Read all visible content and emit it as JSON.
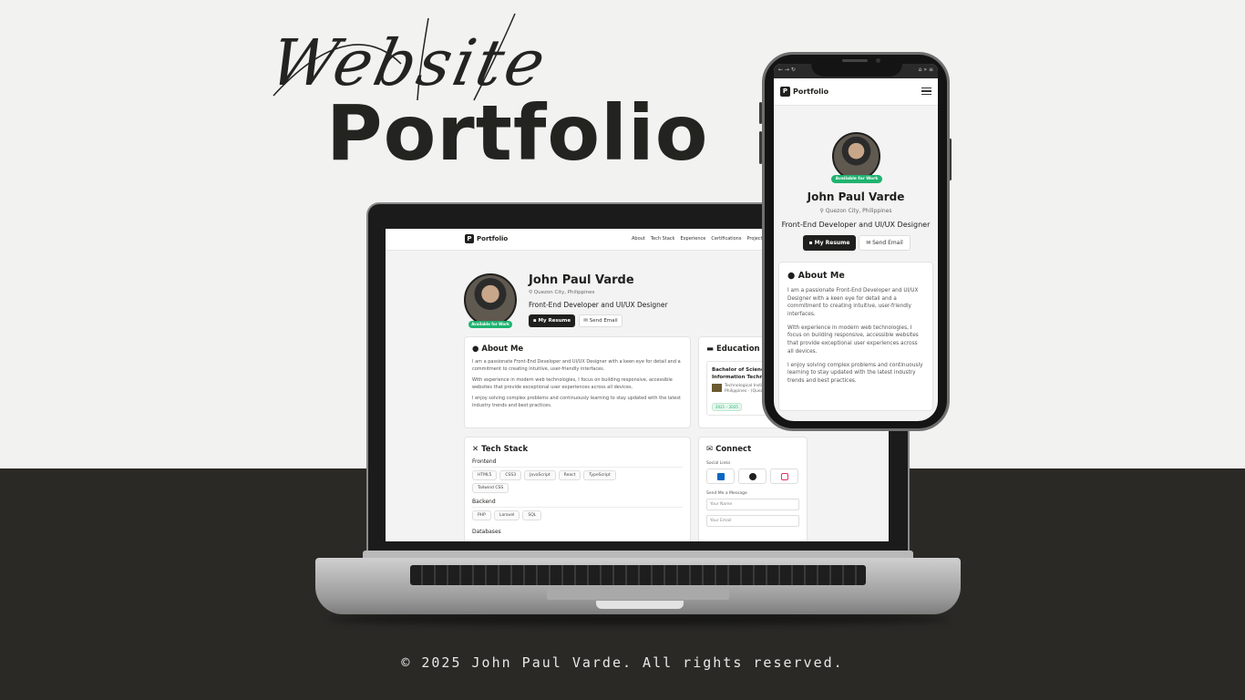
{
  "hero": {
    "script_word": "Website",
    "title": "Portfolio"
  },
  "footer": "© 2025 John Paul Varde. All rights reserved.",
  "site": {
    "logo_letter": "P",
    "logo": "Portfolio",
    "nav": [
      "About",
      "Tech Stack",
      "Experience",
      "Certifications",
      "Projects"
    ],
    "name": "John Paul Varde",
    "location": "Quezon City, Philippines",
    "role": "Front-End Developer and UI/UX Designer",
    "availability": "Available for Work",
    "resume_button": "My Resume",
    "email_button": "Send Email",
    "about": {
      "title": "About Me",
      "p1": "I am a passionate Front-End Developer and UI/UX Designer with a keen eye for detail and a commitment to creating intuitive, user-friendly interfaces.",
      "p2": "With experience in modern web technologies, I focus on building responsive, accessible websites that provide exceptional user experiences across all devices.",
      "p3": "I enjoy solving complex problems and continuously learning to stay updated with the latest industry trends and best practices."
    },
    "education": {
      "title": "Education",
      "degree": "Bachelor of Science in Information Technology",
      "school": "Technological Institute of the Philippines - (Quezon City)",
      "years": "2021 – 2025"
    },
    "tech": {
      "title": "Tech Stack",
      "groups": [
        {
          "name": "Frontend",
          "items": [
            "HTML5",
            "CSS3",
            "JavaScript",
            "React",
            "TypeScript",
            "Tailwind CSS"
          ]
        },
        {
          "name": "Backend",
          "items": [
            "PHP",
            "Laravel",
            "SQL"
          ]
        },
        {
          "name": "Databases",
          "items": []
        }
      ]
    },
    "connect": {
      "title": "Connect",
      "social_label": "Social Links",
      "message_label": "Send Me a Message",
      "name_placeholder": "Your Name",
      "email_placeholder": "Your Email"
    }
  },
  "colors": {
    "dark": "#1f1f1d",
    "band": "#2a2926",
    "available": "#1fb36f",
    "linkedin": "#0a66c2",
    "instagram": "#e1306c"
  }
}
